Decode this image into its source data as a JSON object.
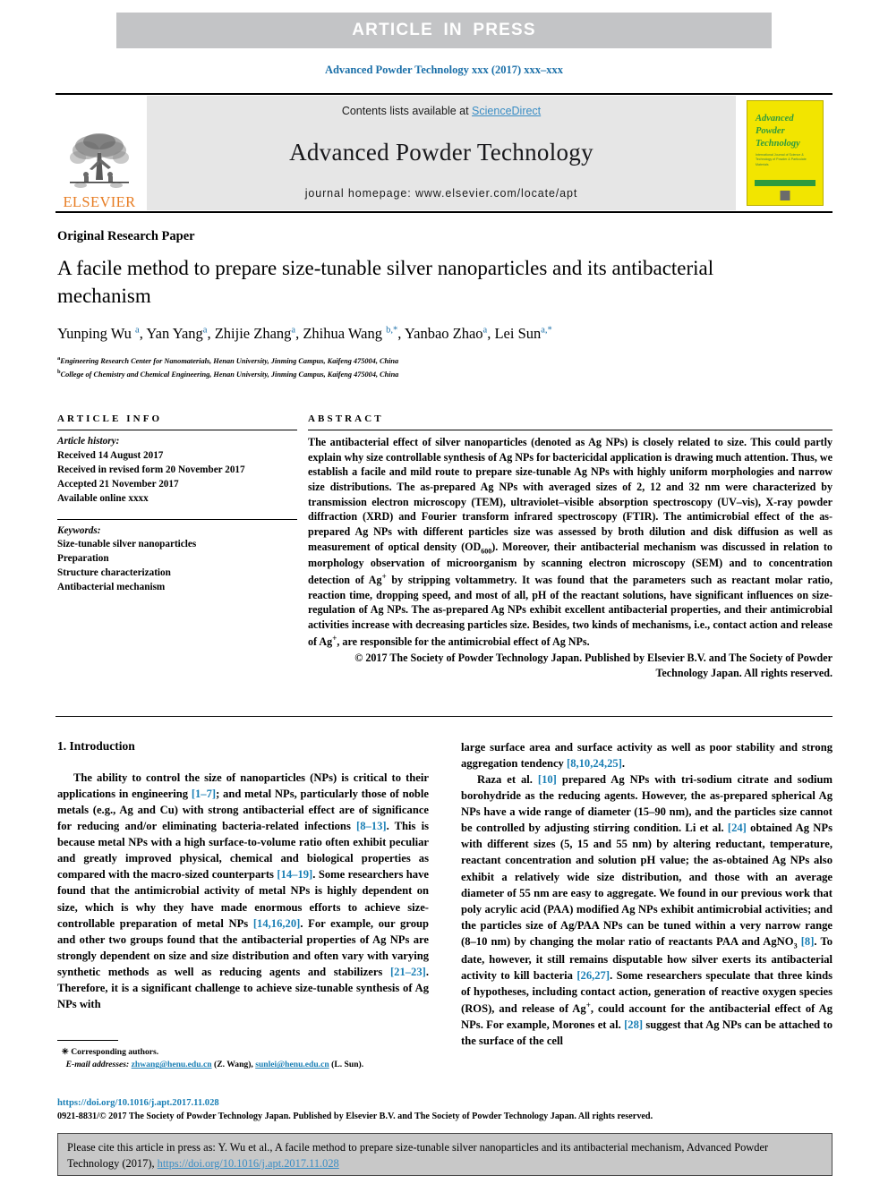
{
  "banner": {
    "text": "ARTICLE IN PRESS"
  },
  "journal_ref": "Advanced Powder Technology xxx (2017) xxx–xxx",
  "masthead": {
    "contents_prefix": "Contents lists available at ",
    "sciencedirect": "ScienceDirect",
    "journal_name": "Advanced Powder Technology",
    "homepage": "journal homepage: www.elsevier.com/locate/apt",
    "publisher_word": "ELSEVIER",
    "cover": {
      "title_line1": "Advanced",
      "title_line2": "Powder",
      "title_line3": "Technology",
      "subtitle": "International Journal of Science & Technology of Powder & Particulate Materials"
    }
  },
  "article": {
    "type": "Original Research Paper",
    "title": "A facile method to prepare size-tunable silver nanoparticles and its antibacterial mechanism",
    "authors_html": "Yunping Wu <sup>a</sup>, Yan Yang<sup>a</sup>, Zhijie Zhang<sup>a</sup>, Zhihua Wang <sup>b,*</sup>, Yanbao Zhao<sup>a</sup>, Lei Sun<sup>a,*</sup>",
    "affiliation_a": "Engineering Research Center for Nanomaterials, Henan University, Jinming Campus, Kaifeng 475004, China",
    "affiliation_b": "College of Chemistry and Chemical Engineering, Henan University, Jinming Campus, Kaifeng 475004, China"
  },
  "info": {
    "heading": "ARTICLE INFO",
    "history_label": "Article history:",
    "history": [
      "Received 14 August 2017",
      "Received in revised form 20 November 2017",
      "Accepted 21 November 2017",
      "Available online xxxx"
    ],
    "keywords_label": "Keywords:",
    "keywords": [
      "Size-tunable silver nanoparticles",
      "Preparation",
      "Structure characterization",
      "Antibacterial mechanism"
    ]
  },
  "abstract": {
    "heading": "ABSTRACT",
    "body_html": "The antibacterial effect of silver nanoparticles (denoted as Ag NPs) is closely related to size. This could partly explain why size controllable synthesis of Ag NPs for bactericidal application is drawing much attention. Thus, we establish a facile and mild route to prepare size-tunable Ag NPs with highly uniform morphologies and narrow size distributions. The as-prepared Ag NPs with averaged sizes of 2, 12 and 32 nm were characterized by transmission electron microscopy (TEM), ultraviolet–visible absorption spectroscopy (UV–vis), X-ray powder diffraction (XRD) and Fourier transform infrared spectroscopy (FTIR). The antimicrobial effect of the as-prepared Ag NPs with different particles size was assessed by broth dilution and disk diffusion as well as measurement of optical density (OD<sub>600</sub>). Moreover, their antibacterial mechanism was discussed in relation to morphology observation of microorganism by scanning electron microscopy (SEM) and to concentration detection of Ag<span class=\"sup-plus\">+</span> by stripping voltammetry. It was found that the parameters such as reactant molar ratio, reaction time, dropping speed, and most of all, pH of the reactant solutions, have significant influences on size-regulation of Ag NPs. The as-prepared Ag NPs exhibit excellent antibacterial properties, and their antimicrobial activities increase with decreasing particles size. Besides, two kinds of mechanisms, i.e., contact action and release of Ag<span class=\"sup-plus\">+</span>, are responsible for the antimicrobial effect of Ag NPs.",
    "copyright": "© 2017 The Society of Powder Technology Japan. Published by Elsevier B.V. and The Society of Powder Technology Japan. All rights reserved."
  },
  "introduction": {
    "heading": "1. Introduction",
    "left_html": "The ability to control the size of nanoparticles (NPs) is critical to their applications in engineering <span class=\"ref\">[1–7]</span>; and metal NPs, particularly those of noble metals (e.g., Ag and Cu) with strong antibacterial effect are of significance for reducing and/or eliminating bacteria-related infections <span class=\"ref\">[8–13]</span>. This is because metal NPs with a high surface-to-volume ratio often exhibit peculiar and greatly improved physical, chemical and biological properties as compared with the macro-sized counterparts <span class=\"ref\">[14–19]</span>. Some researchers have found that the antimicrobial activity of metal NPs is highly dependent on size, which is why they have made enormous efforts to achieve size-controllable preparation of metal NPs <span class=\"ref\">[14,16,20]</span>. For example, our group and other two groups found that the antibacterial properties of Ag NPs are strongly dependent on size and size distribution and often vary with varying synthetic methods as well as reducing agents and stabilizers <span class=\"ref\">[21–23]</span>. Therefore, it is a significant challenge to achieve size-tunable synthesis of Ag NPs with",
    "right_p1_html": "large surface area and surface activity as well as poor stability and strong aggregation tendency <span class=\"ref\">[8,10,24,25]</span>.",
    "right_p2_html": "Raza et al. <span class=\"ref\">[10]</span> prepared Ag NPs with tri-sodium citrate and sodium borohydride as the reducing agents. However, the as-prepared spherical Ag NPs have a wide range of diameter (15–90 nm), and the particles size cannot be controlled by adjusting stirring condition. Li et al. <span class=\"ref\">[24]</span> obtained Ag NPs with different sizes (5, 15 and 55 nm) by altering reductant, temperature, reactant concentration and solution pH value; the as-obtained Ag NPs also exhibit a relatively wide size distribution, and those with an average diameter of 55 nm are easy to aggregate. We found in our previous work that poly acrylic acid (PAA) modified Ag NPs exhibit antimicrobial activities; and the particles size of Ag/PAA NPs can be tuned within a very narrow range (8–10 nm) by changing the molar ratio of reactants PAA and AgNO<sub>3</sub> <span class=\"ref\">[8]</span>. To date, however, it still remains disputable how silver exerts its antibacterial activity to kill bacteria <span class=\"ref\">[26,27]</span>. Some researchers speculate that three kinds of hypotheses, including contact action, generation of reactive oxygen species (ROS), and release of Ag<span class=\"sup-plus\">+</span>, could account for the antibacterial effect of Ag NPs. For example, Morones et al. <span class=\"ref\">[28]</span> suggest that Ag NPs can be attached to the surface of the cell"
  },
  "footnote": {
    "corresponding": "Corresponding authors.",
    "email_label": "E-mail addresses:",
    "email1": "zhwang@henu.edu.cn",
    "email1_name": "(Z. Wang),",
    "email2": "sunlei@henu.edu.cn",
    "email2_name": "(L. Sun)."
  },
  "footer": {
    "doi": "https://doi.org/10.1016/j.apt.2017.11.028",
    "issn_line": "0921-8831/© 2017 The Society of Powder Technology Japan. Published by Elsevier B.V. and The Society of Powder Technology Japan. All rights reserved."
  },
  "cite_box": {
    "text_prefix": "Please cite this article in press as: Y. Wu et al., A facile method to prepare size-tunable silver nanoparticles and its antibacterial mechanism, Advanced Powder Technology (2017), ",
    "link": "https://doi.org/10.1016/j.apt.2017.11.028"
  },
  "colors": {
    "link_blue": "#1a7fb5",
    "banner_gray": "#c3c4c6",
    "cover_yellow": "#f2e500",
    "cover_green": "#2e9b3e",
    "elsevier_orange": "#e77c22"
  }
}
